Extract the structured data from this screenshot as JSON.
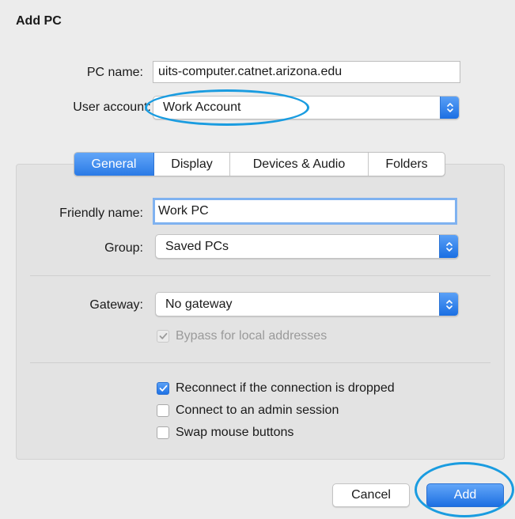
{
  "dialog": {
    "title": "Add PC"
  },
  "pc_name": {
    "label": "PC name:",
    "value": "uits-computer.catnet.arizona.edu"
  },
  "user_account": {
    "label": "User account:",
    "value": "Work Account"
  },
  "tabs": [
    {
      "label": "General",
      "active": true
    },
    {
      "label": "Display",
      "active": false
    },
    {
      "label": "Devices & Audio",
      "active": false
    },
    {
      "label": "Folders",
      "active": false
    }
  ],
  "general": {
    "friendly_name": {
      "label": "Friendly name:",
      "value": "Work PC"
    },
    "group": {
      "label": "Group:",
      "value": "Saved PCs"
    },
    "gateway": {
      "label": "Gateway:",
      "value": "No gateway"
    },
    "bypass_local": {
      "label": "Bypass for local addresses",
      "checked": true,
      "enabled": false
    },
    "reconnect": {
      "label": "Reconnect if the connection is dropped",
      "checked": true
    },
    "admin_session": {
      "label": "Connect to an admin session",
      "checked": false
    },
    "swap_mouse": {
      "label": "Swap mouse buttons",
      "checked": false
    }
  },
  "buttons": {
    "cancel": "Cancel",
    "add": "Add"
  },
  "colors": {
    "accent": "#1f72e5",
    "annotation": "#1a9ce0",
    "window_bg": "#ececec",
    "panel_bg": "#e3e3e3"
  },
  "icons": {
    "popup_stepper": "updown-chevron-icon",
    "checkmark": "checkmark-icon"
  }
}
